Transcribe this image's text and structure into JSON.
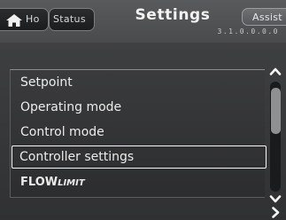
{
  "header": {
    "home_tab_label": "Ho",
    "status_tab_label": "Status",
    "title": "Settings",
    "assist_tab_label": "Assist",
    "menu_code": "3.1.0.0.0.0"
  },
  "menu": {
    "items": [
      {
        "label": "Setpoint",
        "selected": false
      },
      {
        "label": "Operating mode",
        "selected": false
      },
      {
        "label": "Control mode",
        "selected": false
      },
      {
        "label": "Controller settings",
        "selected": true
      },
      {
        "label_main": "FLOW",
        "label_suffix": "LIMIT",
        "selected": false
      }
    ]
  },
  "scrollbar": {
    "position_fraction": 0.06,
    "visible_fraction": 0.42
  },
  "icons": {
    "home": "home-icon",
    "scroll_up": "chevron-up-icon",
    "scroll_down": "chevron-down-icon",
    "next": "chevron-right-icon"
  },
  "colors": {
    "background": "#3d3e40",
    "text": "#ececec",
    "selection_border": "#f4f4f4",
    "scroll_thumb": "#8e9092"
  }
}
